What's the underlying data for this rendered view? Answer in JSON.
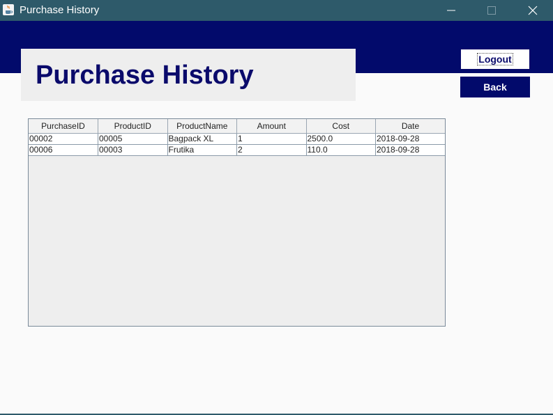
{
  "window": {
    "title": "Purchase History",
    "icon": "java-cup-icon",
    "controls": [
      "minimize-icon",
      "maximize-icon",
      "close-icon"
    ]
  },
  "header": {
    "title": "Purchase History"
  },
  "buttons": {
    "logout": "Logout",
    "back": "Back"
  },
  "table": {
    "columns": [
      "PurchaseID",
      "ProductID",
      "ProductName",
      "Amount",
      "Cost",
      "Date"
    ],
    "rows": [
      [
        "00002",
        "00005",
        "Bagpack XL",
        "1",
        "2500.0",
        "2018-09-28"
      ],
      [
        "00006",
        "00003",
        "Frutika",
        "2",
        "110.0",
        "2018-09-28"
      ]
    ]
  },
  "colors": {
    "titlebar": "#2e5a6a",
    "banner": "#020a6b",
    "title_text": "#0a0a6b",
    "header_panel": "#eeeeee",
    "background": "#fafafa"
  }
}
